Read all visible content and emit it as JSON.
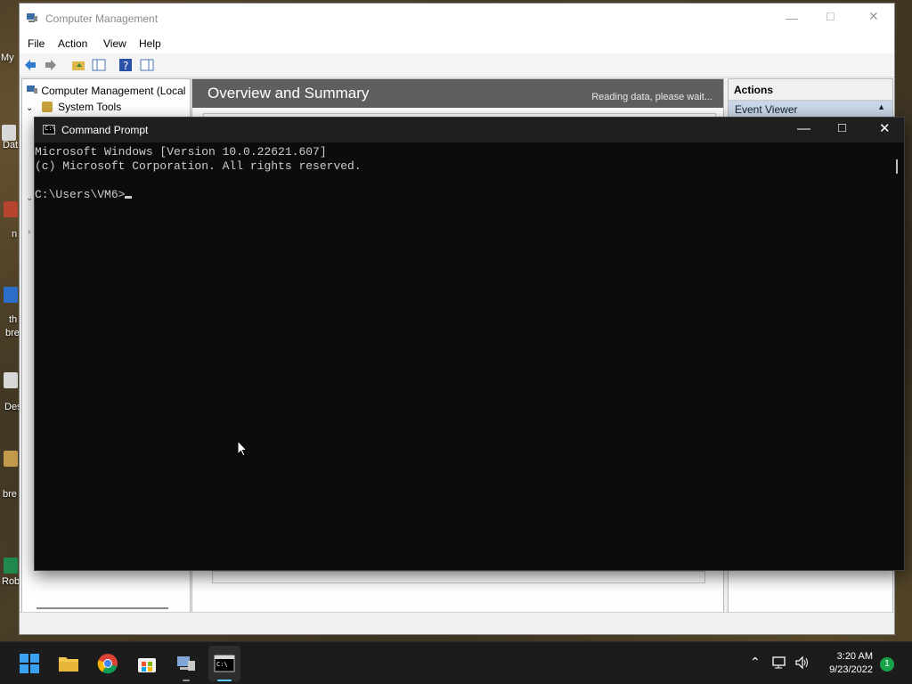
{
  "desktop": {
    "labels": [
      "My",
      "Dat",
      "n",
      "th",
      "bre",
      "Des",
      "bre",
      "Rob"
    ]
  },
  "computer_management": {
    "title": "Computer Management",
    "menu": [
      "File",
      "Action",
      "View",
      "Help"
    ],
    "tree": {
      "root": "Computer Management (Local",
      "system_tools": "System Tools"
    },
    "center": {
      "header": "Overview and Summary",
      "status": "Reading data, please wait..."
    },
    "actions": {
      "header": "Actions",
      "item": "Event Viewer"
    }
  },
  "command_prompt": {
    "title": "Command Prompt",
    "lines": [
      "Microsoft Windows [Version 10.0.22621.607]",
      "(c) Microsoft Corporation. All rights reserved.",
      "",
      "C:\\Users\\VM6>"
    ]
  },
  "taskbar": {
    "time": "3:20 AM",
    "date": "9/23/2022",
    "notification_count": "1"
  }
}
